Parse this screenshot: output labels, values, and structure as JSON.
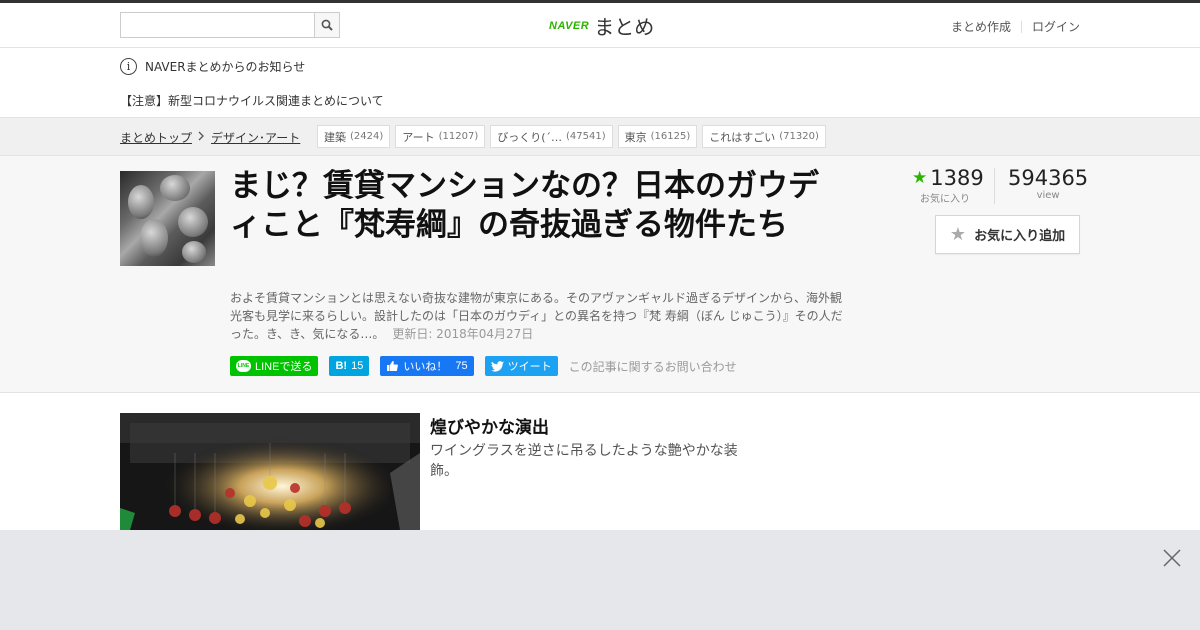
{
  "header": {
    "search_placeholder": "",
    "logo_naver": "NAVER",
    "logo_matome": "まとめ",
    "link_create": "まとめ作成",
    "link_login": "ログイン",
    "search_icon": "search-icon"
  },
  "notice": {
    "title": "NAVERまとめからのお知らせ",
    "item": "【注意】新型コロナウイルス関連まとめについて",
    "icon": "info-icon"
  },
  "breadcrumb": {
    "items": [
      "まとめトップ",
      "デザイン･アート"
    ]
  },
  "tags": [
    {
      "label": "建築",
      "count": "(2424)"
    },
    {
      "label": "アート",
      "count": "(11207)"
    },
    {
      "label": "びっくり(´…",
      "count": "(47541)"
    },
    {
      "label": "東京",
      "count": "(16125)"
    },
    {
      "label": "これはすごい",
      "count": "(71320)"
    }
  ],
  "article": {
    "title": "まじ？賃貸マンションなの？日本のガウディこと『梵寿綱』の奇抜過ぎる物件たち",
    "description": "およそ賃貸マンションとは思えない奇抜な建物が東京にある。そのアヴァンギャルド過ぎるデザインから、海外観光客も見学に来るらしい。設計したのは「日本のガウディ」との異名を持つ『梵 寿綱（ぼん じゅこう）』その人だった。き、き、気になる…。",
    "updated": "更新日: 2018年04月27日",
    "favorites": "1389",
    "favorites_label": "お気に入り",
    "views": "594365",
    "views_label": "view",
    "fav_button": "お気に入り追加"
  },
  "share": {
    "line": "LINEで送る",
    "line_bubble": "LINE",
    "hatena_icon": "B!",
    "hatena_count": "15",
    "fb_label": "いいね！",
    "fb_count": "75",
    "tweet": "ツイート",
    "contact": "この記事に関するお問い合わせ"
  },
  "section": {
    "title": "煌びやかな演出",
    "text": "ワイングラスを逆さに吊るしたような艶やかな装飾。"
  },
  "colors": {
    "naver_green": "#2db400",
    "line_green": "#00c300",
    "hatena_blue": "#00a4de",
    "facebook_blue": "#1877f2",
    "twitter_blue": "#1da1f2"
  }
}
